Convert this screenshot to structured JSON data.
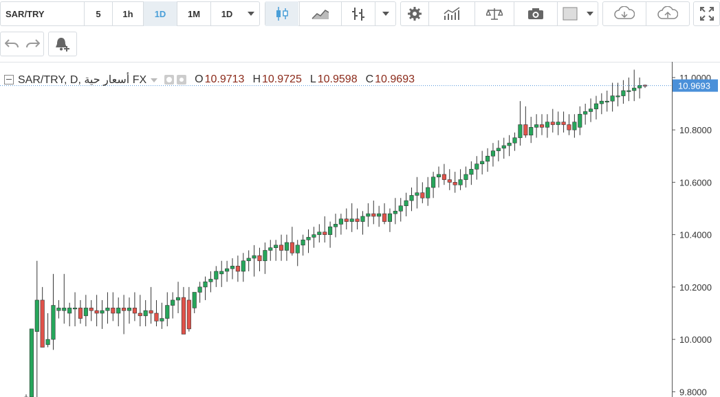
{
  "toolbar": {
    "symbol": "SAR/TRY",
    "intervals": [
      "5",
      "1h",
      "1D",
      "1M",
      "1D"
    ],
    "active_interval": "1D",
    "icons": [
      "chevron-down-icon",
      "candles-icon",
      "area-chart-icon",
      "bars-icon",
      "chevron-down-icon",
      "gear-icon",
      "indicators-icon",
      "compare-scale-icon",
      "camera-icon",
      "color-square-icon",
      "chevron-down-icon",
      "cloud-download-icon",
      "cloud-upload-icon",
      "fullscreen-icon"
    ],
    "undo_icon": "undo-icon",
    "redo_icon": "redo-icon",
    "alert_icon": "add-alert-icon"
  },
  "legend": {
    "title": "SAR/TRY, D, أسعار حية FX",
    "o_label": "O",
    "o_value": "10.9713",
    "h_label": "H",
    "h_value": "10.9725",
    "l_label": "L",
    "l_value": "10.9598",
    "c_label": "C",
    "c_value": "10.9693"
  },
  "colors": {
    "up": "#26a65b",
    "down": "#e0524a",
    "last_price": "#4a90d9",
    "grid": "#e6e6e6"
  },
  "chart_data": {
    "type": "candlestick",
    "ylim": [
      9.78,
      11.06
    ],
    "y_ticks": [
      "9.8000",
      "10.0000",
      "10.2000",
      "10.4000",
      "10.6000",
      "10.8000",
      "11.0000"
    ],
    "last_price_label": "10.9693",
    "last_price": 10.9693,
    "candles": [
      [
        9.77,
        9.79,
        9.76,
        9.78
      ],
      [
        9.78,
        10.04,
        9.77,
        10.04
      ],
      [
        10.03,
        10.3,
        9.74,
        10.15
      ],
      [
        10.15,
        10.2,
        9.98,
        9.97
      ],
      [
        9.98,
        10.1,
        9.97,
        10.0
      ],
      [
        10.0,
        10.25,
        9.96,
        10.13
      ],
      [
        10.11,
        10.15,
        10.08,
        10.12
      ],
      [
        10.11,
        10.25,
        10.06,
        10.12
      ],
      [
        10.1,
        10.14,
        10.05,
        10.12
      ],
      [
        10.12,
        10.18,
        10.05,
        10.12
      ],
      [
        10.12,
        10.15,
        10.06,
        10.08
      ],
      [
        10.09,
        10.17,
        10.05,
        10.12
      ],
      [
        10.12,
        10.15,
        10.07,
        10.11
      ],
      [
        10.11,
        10.17,
        10.05,
        10.1
      ],
      [
        10.1,
        10.15,
        10.04,
        10.11
      ],
      [
        10.11,
        10.18,
        10.06,
        10.12
      ],
      [
        10.12,
        10.18,
        10.07,
        10.1
      ],
      [
        10.1,
        10.16,
        10.05,
        10.12
      ],
      [
        10.12,
        10.17,
        10.02,
        10.11
      ],
      [
        10.11,
        10.16,
        10.06,
        10.12
      ],
      [
        10.12,
        10.18,
        10.07,
        10.1
      ],
      [
        10.1,
        10.17,
        10.05,
        10.09
      ],
      [
        10.09,
        10.15,
        10.05,
        10.11
      ],
      [
        10.11,
        10.2,
        10.06,
        10.1
      ],
      [
        10.1,
        10.15,
        10.05,
        10.07
      ],
      [
        10.07,
        10.14,
        10.04,
        10.08
      ],
      [
        10.08,
        10.18,
        10.05,
        10.13
      ],
      [
        10.13,
        10.18,
        10.08,
        10.15
      ],
      [
        10.15,
        10.22,
        10.1,
        10.16
      ],
      [
        10.16,
        10.2,
        10.03,
        10.02
      ],
      [
        10.15,
        10.2,
        10.03,
        10.04
      ],
      [
        10.12,
        10.18,
        10.1,
        10.18
      ],
      [
        10.18,
        10.22,
        10.14,
        10.2
      ],
      [
        10.2,
        10.24,
        10.15,
        10.22
      ],
      [
        10.22,
        10.26,
        10.18,
        10.23
      ],
      [
        10.23,
        10.28,
        10.2,
        10.26
      ],
      [
        10.25,
        10.3,
        10.2,
        10.26
      ],
      [
        10.26,
        10.3,
        10.22,
        10.27
      ],
      [
        10.27,
        10.31,
        10.23,
        10.28
      ],
      [
        10.28,
        10.32,
        10.22,
        10.26
      ],
      [
        10.26,
        10.33,
        10.22,
        10.3
      ],
      [
        10.3,
        10.34,
        10.26,
        10.31
      ],
      [
        10.31,
        10.36,
        10.24,
        10.32
      ],
      [
        10.32,
        10.35,
        10.26,
        10.3
      ],
      [
        10.3,
        10.37,
        10.25,
        10.34
      ],
      [
        10.34,
        10.38,
        10.3,
        10.35
      ],
      [
        10.35,
        10.38,
        10.3,
        10.36
      ],
      [
        10.36,
        10.4,
        10.3,
        10.34
      ],
      [
        10.34,
        10.4,
        10.3,
        10.37
      ],
      [
        10.37,
        10.43,
        10.32,
        10.33
      ],
      [
        10.33,
        10.38,
        10.28,
        10.36
      ],
      [
        10.36,
        10.4,
        10.32,
        10.38
      ],
      [
        10.38,
        10.42,
        10.33,
        10.39
      ],
      [
        10.39,
        10.43,
        10.35,
        10.4
      ],
      [
        10.4,
        10.44,
        10.37,
        10.41
      ],
      [
        10.41,
        10.47,
        10.37,
        10.4
      ],
      [
        10.4,
        10.45,
        10.35,
        10.43
      ],
      [
        10.43,
        10.48,
        10.39,
        10.44
      ],
      [
        10.44,
        10.48,
        10.4,
        10.46
      ],
      [
        10.46,
        10.5,
        10.42,
        10.45
      ],
      [
        10.45,
        10.52,
        10.41,
        10.46
      ],
      [
        10.46,
        10.5,
        10.42,
        10.45
      ],
      [
        10.45,
        10.49,
        10.4,
        10.47
      ],
      [
        10.47,
        10.52,
        10.43,
        10.48
      ],
      [
        10.48,
        10.53,
        10.44,
        10.47
      ],
      [
        10.47,
        10.51,
        10.43,
        10.48
      ],
      [
        10.48,
        10.52,
        10.44,
        10.45
      ],
      [
        10.45,
        10.5,
        10.41,
        10.48
      ],
      [
        10.48,
        10.54,
        10.44,
        10.49
      ],
      [
        10.49,
        10.54,
        10.45,
        10.51
      ],
      [
        10.51,
        10.56,
        10.47,
        10.53
      ],
      [
        10.53,
        10.58,
        10.49,
        10.55
      ],
      [
        10.55,
        10.62,
        10.5,
        10.56
      ],
      [
        10.56,
        10.6,
        10.52,
        10.54
      ],
      [
        10.54,
        10.62,
        10.51,
        10.58
      ],
      [
        10.58,
        10.64,
        10.54,
        10.62
      ],
      [
        10.62,
        10.66,
        10.58,
        10.63
      ],
      [
        10.63,
        10.67,
        10.59,
        10.61
      ],
      [
        10.61,
        10.65,
        10.57,
        10.6
      ],
      [
        10.6,
        10.64,
        10.56,
        10.59
      ],
      [
        10.59,
        10.65,
        10.57,
        10.61
      ],
      [
        10.61,
        10.66,
        10.58,
        10.63
      ],
      [
        10.63,
        10.68,
        10.59,
        10.65
      ],
      [
        10.65,
        10.7,
        10.61,
        10.67
      ],
      [
        10.67,
        10.72,
        10.63,
        10.68
      ],
      [
        10.68,
        10.73,
        10.64,
        10.7
      ],
      [
        10.7,
        10.75,
        10.66,
        10.72
      ],
      [
        10.72,
        10.76,
        10.68,
        10.73
      ],
      [
        10.73,
        10.77,
        10.69,
        10.74
      ],
      [
        10.74,
        10.78,
        10.7,
        10.75
      ],
      [
        10.75,
        10.79,
        10.72,
        10.77
      ],
      [
        10.77,
        10.91,
        10.74,
        10.82
      ],
      [
        10.82,
        10.89,
        10.77,
        10.78
      ],
      [
        10.78,
        10.85,
        10.75,
        10.81
      ],
      [
        10.81,
        10.86,
        10.77,
        10.82
      ],
      [
        10.82,
        10.86,
        10.78,
        10.81
      ],
      [
        10.81,
        10.86,
        10.77,
        10.83
      ],
      [
        10.83,
        10.88,
        10.79,
        10.82
      ],
      [
        10.82,
        10.87,
        10.78,
        10.83
      ],
      [
        10.83,
        10.87,
        10.79,
        10.82
      ],
      [
        10.82,
        10.86,
        10.78,
        10.8
      ],
      [
        10.8,
        10.86,
        10.77,
        10.83
      ],
      [
        10.81,
        10.89,
        10.78,
        10.86
      ],
      [
        10.86,
        10.9,
        10.82,
        10.87
      ],
      [
        10.87,
        10.92,
        10.83,
        10.88
      ],
      [
        10.88,
        10.93,
        10.84,
        10.9
      ],
      [
        10.9,
        10.94,
        10.86,
        10.91
      ],
      [
        10.91,
        10.95,
        10.87,
        10.91
      ],
      [
        10.91,
        10.98,
        10.87,
        10.93
      ],
      [
        10.93,
        10.98,
        10.89,
        10.93
      ],
      [
        10.93,
        10.99,
        10.9,
        10.95
      ],
      [
        10.95,
        11.0,
        10.91,
        10.95
      ],
      [
        10.95,
        11.03,
        10.91,
        10.96
      ],
      [
        10.96,
        11.0,
        10.92,
        10.97
      ],
      [
        10.971,
        10.973,
        10.96,
        10.969
      ]
    ]
  }
}
